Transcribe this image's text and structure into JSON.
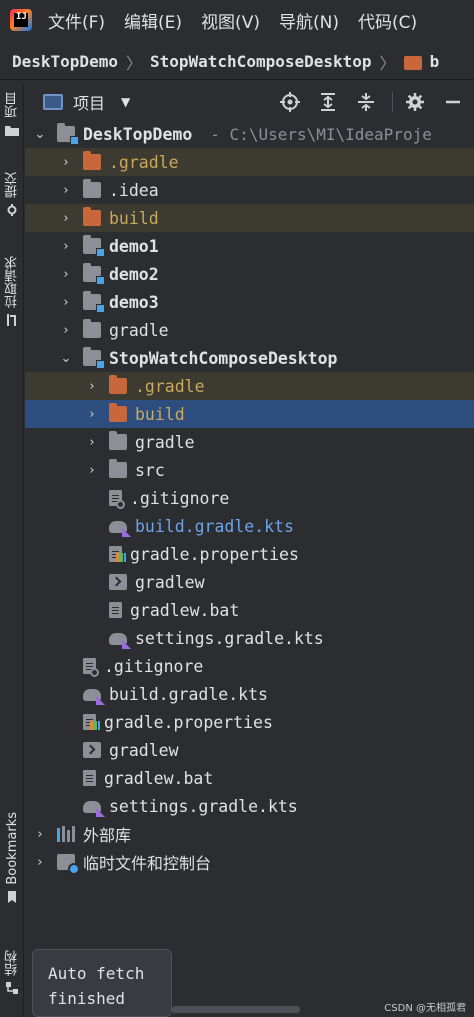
{
  "menu": {
    "items": [
      "文件(F)",
      "编辑(E)",
      "视图(V)",
      "导航(N)",
      "代码(C)"
    ]
  },
  "breadcrumb": {
    "items": [
      "DeskTopDemo",
      "StopWatchComposeDesktop",
      "b"
    ]
  },
  "left_strip": {
    "project": "项目",
    "commit": "提交",
    "pull_requests": "拉取请求",
    "bookmarks": "Bookmarks",
    "structure": "结构"
  },
  "panel": {
    "title": "项目",
    "icons": [
      "locate-icon",
      "expand-all-icon",
      "collapse-all-icon",
      "settings-icon",
      "hide-icon"
    ]
  },
  "tree": {
    "root": {
      "label": "DeskTopDemo",
      "path": "- C:\\Users\\MI\\IdeaProje"
    },
    "rows": [
      {
        "label": ".gradle",
        "icon": "folder-orange",
        "style": "orange",
        "excluded": true,
        "chevron": "›"
      },
      {
        "label": ".idea",
        "icon": "folder-grey",
        "style": "",
        "excluded": false,
        "chevron": "›"
      },
      {
        "label": "build",
        "icon": "folder-orange",
        "style": "orange",
        "excluded": true,
        "chevron": "›"
      },
      {
        "label": "demo1",
        "icon": "module",
        "style": "bold",
        "excluded": false,
        "chevron": "›"
      },
      {
        "label": "demo2",
        "icon": "module",
        "style": "bold",
        "excluded": false,
        "chevron": "›"
      },
      {
        "label": "demo3",
        "icon": "module",
        "style": "bold",
        "excluded": false,
        "chevron": "›"
      },
      {
        "label": "gradle",
        "icon": "folder-grey",
        "style": "",
        "excluded": false,
        "chevron": "›"
      },
      {
        "label": "StopWatchComposeDesktop",
        "icon": "module",
        "style": "bold",
        "excluded": false,
        "chevron": "⌄"
      },
      {
        "label": ".gradle",
        "icon": "folder-orange",
        "style": "orange",
        "excluded": true,
        "chevron": "›"
      },
      {
        "label": "build",
        "icon": "folder-orange",
        "style": "orange",
        "excluded": true,
        "selected": true,
        "chevron": "›"
      },
      {
        "label": "gradle",
        "icon": "folder-grey",
        "style": "",
        "excluded": false,
        "chevron": "›"
      },
      {
        "label": "src",
        "icon": "folder-grey",
        "style": "",
        "excluded": false,
        "chevron": "›"
      },
      {
        "label": ".gitignore",
        "icon": "gitignore",
        "style": "",
        "excluded": false,
        "chevron": ""
      },
      {
        "label": "build.gradle.kts",
        "icon": "kts",
        "style": "blue",
        "excluded": false,
        "chevron": ""
      },
      {
        "label": "gradle.properties",
        "icon": "properties",
        "style": "",
        "excluded": false,
        "chevron": ""
      },
      {
        "label": "gradlew",
        "icon": "terminal",
        "style": "",
        "excluded": false,
        "chevron": ""
      },
      {
        "label": "gradlew.bat",
        "icon": "doc",
        "style": "",
        "excluded": false,
        "chevron": ""
      },
      {
        "label": "settings.gradle.kts",
        "icon": "kts",
        "style": "",
        "excluded": false,
        "chevron": ""
      },
      {
        "label": ".gitignore",
        "icon": "gitignore",
        "style": "",
        "excluded": false,
        "chevron": ""
      },
      {
        "label": "build.gradle.kts",
        "icon": "kts",
        "style": "",
        "excluded": false,
        "chevron": ""
      },
      {
        "label": "gradle.properties",
        "icon": "properties",
        "style": "",
        "excluded": false,
        "chevron": ""
      },
      {
        "label": "gradlew",
        "icon": "terminal",
        "style": "",
        "excluded": false,
        "chevron": ""
      },
      {
        "label": "gradlew.bat",
        "icon": "doc",
        "style": "",
        "excluded": false,
        "chevron": ""
      },
      {
        "label": "settings.gradle.kts",
        "icon": "kts",
        "style": "",
        "excluded": false,
        "chevron": ""
      },
      {
        "label": "外部库",
        "icon": "libraries",
        "style": "sans",
        "excluded": false,
        "chevron": "›"
      },
      {
        "label": "临时文件和控制台",
        "icon": "scratches",
        "style": "sans",
        "excluded": false,
        "chevron": "›"
      }
    ]
  },
  "notification": {
    "line1": "Auto fetch",
    "line2": "finished"
  },
  "watermark": "CSDN @无相孤君",
  "colors": {
    "background": "#2b2d30",
    "selection": "#2e4d7f",
    "excluded_bg": "#3d3a32",
    "excluded_text": "#c9a95b",
    "modified_text": "#6fa4e8"
  }
}
